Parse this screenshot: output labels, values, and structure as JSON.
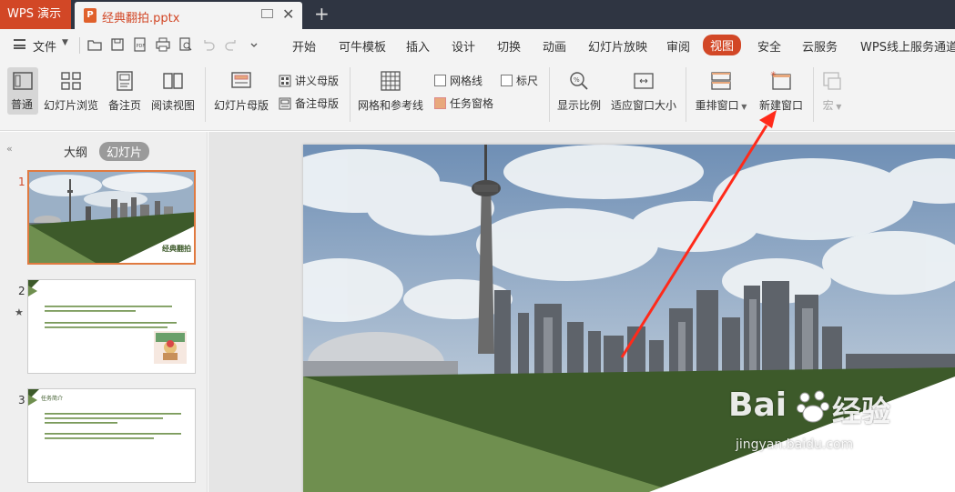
{
  "titlebar": {
    "app_name": "WPS 演示",
    "doc_tab_name": "经典翻拍.pptx",
    "ppt_icon_letter": "P",
    "new_tab_symbol": "+"
  },
  "menubar": {
    "file_label": "文件",
    "tabs": [
      "开始",
      "可牛模板",
      "插入",
      "设计",
      "切换",
      "动画",
      "幻灯片放映",
      "审阅",
      "视图",
      "安全",
      "云服务",
      "WPS线上服务通道"
    ],
    "active_tab": "视图"
  },
  "ribbon": {
    "normal": "普通",
    "slide_browse": "幻灯片浏览",
    "notes_page": "备注页",
    "reading_view": "阅读视图",
    "slide_master": "幻灯片母版",
    "handout_master": "讲义母版",
    "notes_master": "备注母版",
    "grid_and_guides": "网格和参考线",
    "gridlines": "网格线",
    "ruler": "标尺",
    "task_pane": "任务窗格",
    "zoom": "显示比例",
    "fit_window": "适应窗口大小",
    "arrange_windows": "重排窗口",
    "new_window": "新建窗口",
    "macro": "宏"
  },
  "leftpanel": {
    "outline_tab": "大纲",
    "slides_tab": "幻灯片",
    "slides": [
      {
        "num": "1",
        "title_text": "经典翻拍"
      },
      {
        "num": "2"
      },
      {
        "num": "3",
        "heading": "任务简介"
      }
    ]
  },
  "watermark": {
    "brand": "Bai",
    "brand2": "经验",
    "url": "jingyan.baidu.com"
  },
  "colors": {
    "accent": "#d24726",
    "dark_green": "#3d5a2a",
    "light_green": "#6f8f4f",
    "arrow_red": "#ff2a1a"
  }
}
